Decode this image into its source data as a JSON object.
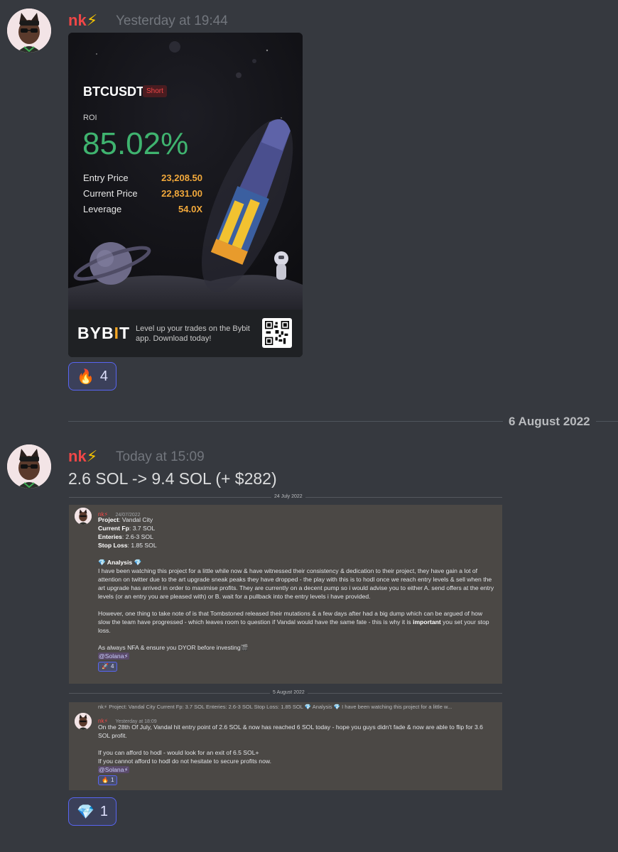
{
  "message1": {
    "username": "nk",
    "username_emoji": "⚡",
    "timestamp": "Yesterday at 19:44",
    "card": {
      "pair": "BTCUSDT",
      "side": "Short",
      "roi_label": "ROI",
      "roi_value": "85.02%",
      "rows": [
        {
          "label": "Entry Price",
          "value": "23,208.50"
        },
        {
          "label": "Current Price",
          "value": "22,831.00"
        },
        {
          "label": "Leverage",
          "value": "54.0X"
        }
      ],
      "brand_pre": "BYB",
      "brand_i": "I",
      "brand_post": "T",
      "tagline": "Level up your trades on the Bybit app. Download today!"
    },
    "reaction": {
      "emoji": "🔥",
      "count": "4"
    }
  },
  "date_divider": "6 August 2022",
  "message2": {
    "username": "nk",
    "username_emoji": "⚡",
    "timestamp": "Today at 15:09",
    "text": "2.6 SOL -> 9.4 SOL (+ $282)",
    "reaction": {
      "emoji": "💎",
      "count": "1"
    }
  },
  "embed": {
    "date1": "24 July 2022",
    "post1": {
      "username": "nk⚡",
      "timestamp": "24/07/2022",
      "project_label": "Project",
      "project_value": ": Vandal City",
      "fp_label": "Current Fp",
      "fp_value": ": 3.7 SOL",
      "entries_label": "Enteries",
      "entries_value": ": 2.6-3 SOL",
      "stop_label": "Stop Loss",
      "stop_value": ": 1.85 SOL",
      "analysis_label": "💎 Analysis 💎",
      "para1": "I have been watching this project for a little while now & have witnessed their consistency & dedication to their project, they have gain a lot of attention on twitter due to the art upgrade sneak peaks they have dropped - the play with this is to hodl once we reach entry levels & sell when the art upgrade has arrived in order to maximise profits. They are currently on a decent pump so i would advise you to either A. send offers at the entry levels (or an entry you are pleased with) or B. wait for a pullback into the entry levels i have provided.",
      "para2_pre": " However, one thing to take note of is that Tombstoned released their mutations & a few days after had a big dump which can be argued of how slow the team have progressed - which leaves room to question if Vandal would have the same fate - this is why it is ",
      "para2_bold": "important",
      "para2_post": " you set your stop loss.",
      "closing": "As always NFA & ensure you DYOR before investing🎬",
      "mention": "@Solana⚡",
      "reaction_emoji": "🚀",
      "reaction_count": "4"
    },
    "date2": "5 August 2022",
    "post2": {
      "reply_preview": "nk⚡  Project: Vandal City Current Fp: 3.7 SOL  Enteries: 2.6-3 SOL Stop Loss: 1.85 SOL  💎 Analysis 💎  I have been watching this project for a little w...",
      "username": "nk⚡",
      "timestamp": "Yesterday at 18:09",
      "para1": "On the 28th Of July, Vandal hit entry point of 2.6 SOL & now has reached 6 SOL today - hope you guys didn't fade & now are able to flip for 3.6 SOL profit.",
      "para2": "If you can afford to hodl - would look for an exit of 6.5 SOL+",
      "para3": "If you cannot afford to hodl do not hesitate to secure profits now.",
      "mention": "@Solana⚡",
      "reaction_emoji": "🔥",
      "reaction_count": "1"
    }
  },
  "colors": {
    "background": "#36393f",
    "username": "#f04747",
    "roi_green": "#3fb36f",
    "value_orange": "#f2a93b",
    "reaction_border": "#5865f2"
  }
}
